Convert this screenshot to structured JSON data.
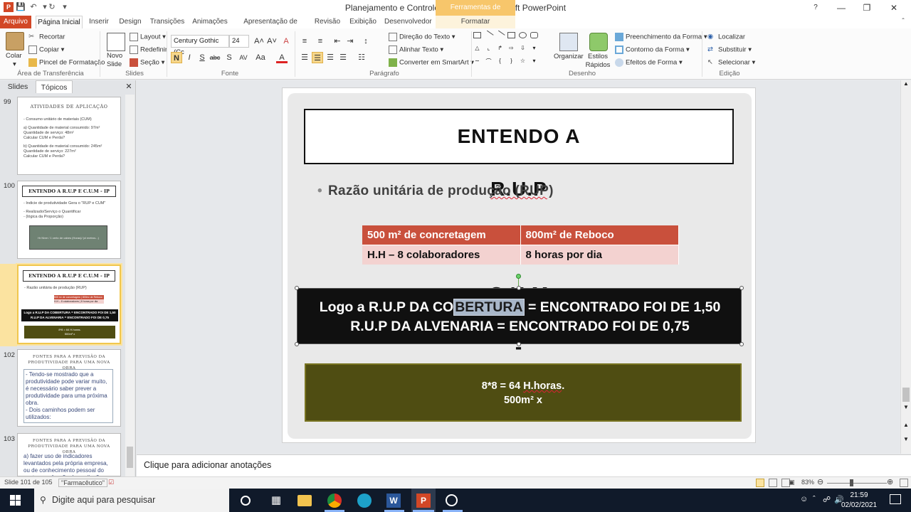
{
  "window": {
    "title": "Planejamento e Controle de OBras - Microsoft PowerPoint",
    "context_tab": "Ferramentas de Desenho",
    "controls": {
      "help": "?",
      "minimize": "—",
      "maximize": "❐",
      "close": "✕"
    }
  },
  "tabs": [
    "Arquivo",
    "Página Inicial",
    "Inserir",
    "Design",
    "Transições",
    "Animações",
    "Apresentação de Slides",
    "Revisão",
    "Exibição",
    "Desenvolvedor",
    "Formatar"
  ],
  "ribbon": {
    "clipboard": {
      "paste": "Colar",
      "cut": "Recortar",
      "copy": "Copiar",
      "painter": "Pincel de Formatação",
      "label": "Área de Transferência"
    },
    "slides": {
      "new": "Novo Slide",
      "layout": "Layout",
      "reset": "Redefinir",
      "section": "Seção",
      "label": "Slides"
    },
    "font": {
      "name": "Century Gothic (Cc",
      "size": "24",
      "label": "Fonte",
      "bold": "N",
      "italic": "I",
      "underline": "S",
      "strike": "abc",
      "shadow": "S",
      "spacing": "AV",
      "case": "Aa",
      "color": "A",
      "grow": "A˄",
      "shrink": "A˅",
      "clear": "A"
    },
    "paragraph": {
      "direction": "Direção do Texto",
      "align": "Alinhar Texto",
      "smartart": "Converter em SmartArt",
      "label": "Parágrafo"
    },
    "drawing": {
      "arrange": "Organizar",
      "styles": "Estilos Rápidos",
      "fill": "Preenchimento da Forma",
      "outline": "Contorno da Forma",
      "effects": "Efeitos de Forma",
      "label": "Desenho"
    },
    "editing": {
      "find": "Localizar",
      "replace": "Substituir",
      "select": "Selecionar",
      "label": "Edição"
    }
  },
  "left_pane": {
    "tabs": [
      "Slides",
      "Tópicos"
    ],
    "close": "✕",
    "thumbs": [
      {
        "num": "99",
        "title": "ATIVIDADES DE APLICAÇÃO",
        "lines": [
          "- Consumo unitário de materiais (CUM)",
          "",
          "a) Quantidade de material consumido: 97m²",
          "Quantidade de serviço: 48m²",
          "Calcular CUM e Perda?",
          "",
          "b) Quantidade de material consumido: 245m²",
          "Quantidade de serviço: 227m²",
          "Calcular CUM e Perda?"
        ]
      },
      {
        "num": "100",
        "title": "ENTENDO A R.U.P E C.U.M - IP",
        "lines": [
          "- Indicie de produtividade Gera o \"RUP e CUM\"",
          "",
          "- Realizado/Serviço o Quantificar",
          "- (lógica da Proporção)"
        ],
        "box": "Hr Nbre / 1 certo de cabes (Horas)/ (cl metros...)"
      },
      {
        "num": "101",
        "title": "ENTENDO A R.U.P E C.U.M - IP",
        "lines": [
          "- Razão unitária de produção (RUP)"
        ],
        "black1": "Logo a R.U.P DA COBERTURA = ENCONTRADO FOI DE 1,50",
        "black2": "R.U.P DA ALVENARIA = ENCONTRADO FOI DE 0,75",
        "green1": "8*8 = 64 H.horas.",
        "green2": "500m² x",
        "mini_t1": "500 m² de concretagem",
        "mini_t2": "800m² de Reboco",
        "mini_t3": "H.H – 8 colaboradores",
        "mini_t4": "8 horas por dia"
      },
      {
        "num": "102",
        "title": "FONTES PARA A PREVISÃO DA PRODUTIVIDADE PARA UMA NOVA OBRA",
        "lines": [
          "- Tendo-se mostrado que a produtividade pode variar muito, é necessário saber prever a produtividade para uma próxima obra.",
          "- Dois caminhos podem ser utilizados:"
        ]
      },
      {
        "num": "103",
        "title": "FONTES PARA A PREVISÃO DA PRODUTIVIDADE PARA UMA NOVA OBRA",
        "lines": [
          "a) fazer uso de indicadores levantados pela própria empresa, ou de conhecimento pessoal do gestor, em função de avaliações"
        ]
      }
    ]
  },
  "slide": {
    "title": "ENTENDO A R.U.P E C.U.M - IP",
    "title_parts": [
      "ENTENDO A ",
      "R.U.P",
      " E ",
      "C.U.M",
      " - ",
      "IP"
    ],
    "bullet": "Razão unitária de produção (RUP)",
    "table": [
      [
        "500 m² de concretagem",
        "800m² de Reboco"
      ],
      [
        "H.H – 8 colaboradores",
        "8 horas por dia"
      ]
    ],
    "black_line1_a": "Logo a R.U.P DA CO",
    "black_line1_sel": "BERTURA",
    "black_line1_b": " = ENCONTRADO FOI DE 1,50",
    "black_line2": "R.U.P DA ALVENARIA = ENCONTRADO FOI DE 0,75",
    "green_line1_a": "8*8 = 64 ",
    "green_line1_b": "H.horas",
    "green_line1_c": ".",
    "green_line2": "500m² x"
  },
  "notes_placeholder": "Clique para adicionar anotações",
  "status": {
    "slide": "Slide 101 de 105",
    "theme": "\"Farmacêutico\"",
    "zoom": "83%",
    "zoom_minus": "⊖",
    "zoom_plus": "⊕"
  },
  "taskbar": {
    "search_placeholder": "Digite aqui para pesquisar",
    "time": "21:59",
    "date": "02/02/2021"
  },
  "colors": {
    "file_tab": "#d24726",
    "table_header": "#c9503c",
    "table_row": "#f3d2d0",
    "green_box": "#4f4d12",
    "selection": "#f1c74d"
  }
}
